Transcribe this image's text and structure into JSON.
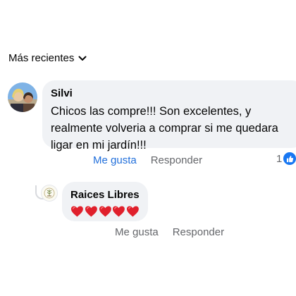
{
  "sort": {
    "label": "Más recientes",
    "icon": "chevron-down-icon"
  },
  "comments": [
    {
      "author": "Silvi",
      "text": "Chicos las compre!!! Son excelentes, y\nrealmente volveria a comprar si me quedara\nligar en mi jardín!!!",
      "like_label": "Me gusta",
      "reply_label": "Responder",
      "reaction_count": "1",
      "reaction_icon": "like-thumb-icon"
    }
  ],
  "reply": {
    "author": "Raices Libres",
    "content_icons": [
      "red-heart-icon",
      "red-heart-icon",
      "red-heart-icon",
      "red-heart-icon",
      "red-heart-icon"
    ],
    "like_label": "Me gusta",
    "reply_label": "Responder"
  },
  "colors": {
    "accent": "#216fdb",
    "bubble": "#f0f2f5",
    "muted": "#65676b",
    "heart": "#e0202c"
  }
}
